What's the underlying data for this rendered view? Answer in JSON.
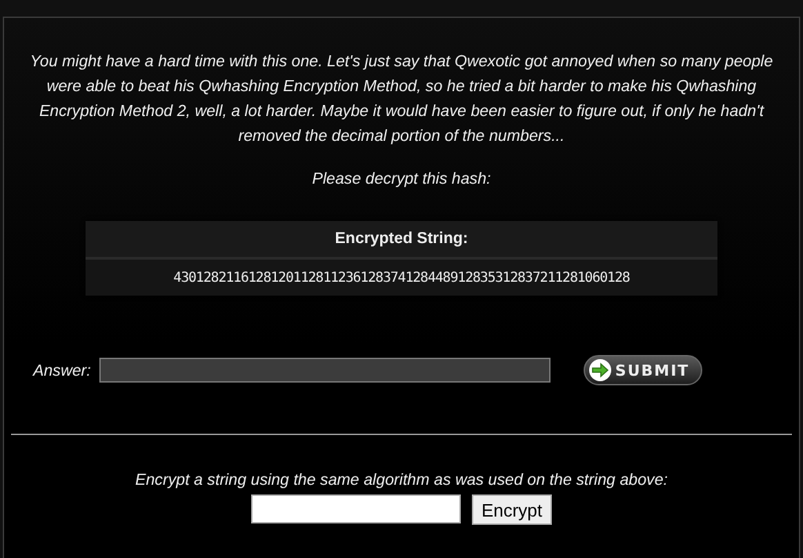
{
  "intro": "You might have a hard time with this one. Let's just say that Qwexotic got annoyed when so many people were able to beat his Qwhashing Encryption Method, so he tried a bit harder to make his Qwhashing Encryption Method 2, well, a lot harder. Maybe it would have been easier to figure out, if only he hadn't removed the decimal portion of the numbers...",
  "prompt": "Please decrypt this hash:",
  "hash_table": {
    "header": "Encrypted String:",
    "value": "4301282116128120112811236128374128448912835312837211281060128"
  },
  "answer": {
    "label": "Answer:",
    "submit": "SUBMIT"
  },
  "encrypt": {
    "text": "Encrypt a string using the same algorithm as was used on the string above:",
    "button": "Encrypt"
  }
}
